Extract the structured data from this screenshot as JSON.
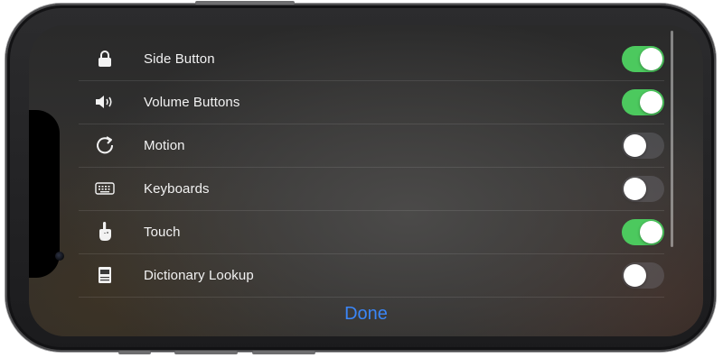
{
  "settings": {
    "items": [
      {
        "label": "Side Button",
        "icon": "lock-icon",
        "enabled": true
      },
      {
        "label": "Volume Buttons",
        "icon": "speaker-volume-icon",
        "enabled": true
      },
      {
        "label": "Motion",
        "icon": "rotate-icon",
        "enabled": false
      },
      {
        "label": "Keyboards",
        "icon": "keyboard-icon",
        "enabled": false
      },
      {
        "label": "Touch",
        "icon": "hand-touch-icon",
        "enabled": true
      },
      {
        "label": "Dictionary Lookup",
        "icon": "dictionary-icon",
        "enabled": false
      }
    ]
  },
  "footer": {
    "done_label": "Done"
  },
  "colors": {
    "toggle_on": "#4cc95e",
    "accent": "#3b86f7"
  }
}
